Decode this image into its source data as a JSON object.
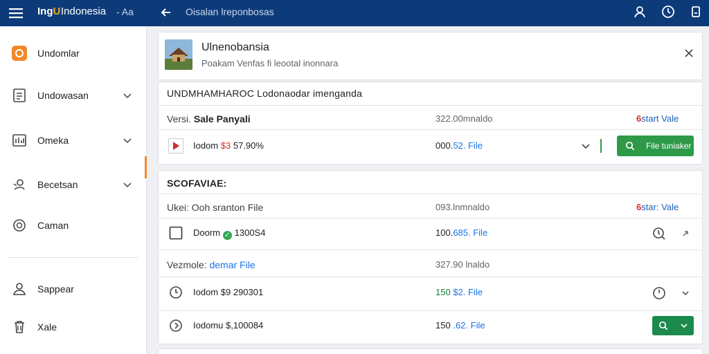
{
  "topbar": {
    "logo_text": "Ing",
    "logo_u": "U",
    "title": "Indonesia",
    "subtitle": "- Aa",
    "breadcrumb": "Oisalan lreponbosas"
  },
  "sidebar": {
    "items": [
      {
        "label": "Undomlar",
        "icon": "home-badge-icon"
      },
      {
        "label": "Undowasan",
        "icon": "document-icon"
      },
      {
        "label": "Omeka",
        "icon": "chart-icon"
      },
      {
        "label": "Becetsan",
        "icon": "person-pin-icon"
      },
      {
        "label": "Caman",
        "icon": "coin-icon"
      },
      {
        "label": "Sappear",
        "icon": "user-icon"
      },
      {
        "label": "Xale",
        "icon": "trash-icon"
      }
    ]
  },
  "header_card": {
    "title": "Ulnenobansia",
    "subtitle": "Poakam Venfas fi leootal inonnara"
  },
  "section1": {
    "title": "UNDMHAMHAROC Lodonaodar imenganda",
    "header": {
      "label": "Versi.",
      "label_bold": "Sale Panyali",
      "amount": "322.00mnaldo",
      "status_red": "6",
      "status_text": "start Vale"
    },
    "row": {
      "name": "Iodom",
      "price": "$3",
      "price_rest": "57.90%",
      "amount": "000.",
      "amount_blue": "52. File",
      "button": "File tuniaker"
    }
  },
  "section2": {
    "title": "SCOFAVIAE:",
    "header1": {
      "label": "Ukei:",
      "label_rest": "Ooh sranton File",
      "amount": "093.lnmnaldo",
      "status_red": "6",
      "status_text": "star: Vale"
    },
    "row1": {
      "name": "Doorm",
      "price": "1300S4",
      "amount": "100.",
      "amount_blue": "685. File"
    },
    "header2": {
      "label": "Vezmole:",
      "label_blue": "demar File",
      "amount": "327.90 lnaldo"
    },
    "row2": {
      "name": "Iodom",
      "price": "$9 290301",
      "amount_green": "150",
      "amount_blue": "$2. File"
    },
    "row3": {
      "name": "Iodomu",
      "price": "$,100084",
      "amount": "150",
      "amount_blue": ".62. File"
    }
  },
  "colors": {
    "topbar": "#0d3b7a",
    "accent_orange": "#f0892a",
    "green": "#2e9a48",
    "red": "#d93025",
    "blue": "#1a73e8"
  }
}
